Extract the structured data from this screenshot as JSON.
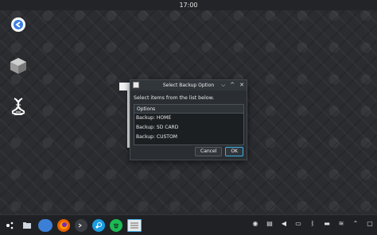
{
  "clock": "17:00",
  "desktop": {
    "icons": [
      "return-icon",
      "cube-package-icon",
      "dna-icon"
    ]
  },
  "dialog": {
    "title": "Select Backup Option",
    "prompt": "Select items from the list below.",
    "list_header": "Options",
    "options": [
      "Backup: HOME",
      "Backup: SD CARD",
      "Backup: CUSTOM"
    ],
    "cancel_label": "Cancel",
    "ok_label": "OK",
    "controls": [
      "⌵",
      "^",
      "✕"
    ]
  },
  "taskbar": {
    "apps": [
      "app-launcher-icon",
      "file-manager-icon",
      "browser-folder-icon",
      "firefox-icon",
      "terminal-icon",
      "steam-icon",
      "spotify-icon",
      "window-task-icon"
    ],
    "tray": [
      "media-icon",
      "clipboard-icon",
      "volume-icon",
      "battery-icon",
      "bluetooth-icon",
      "storage-icon",
      "network-icon",
      "expand-icon",
      "desktop-icon"
    ]
  },
  "colors": {
    "accent": "#3daee9",
    "dialog_bg": "#2a2e32",
    "panel_bg": "#202124"
  }
}
